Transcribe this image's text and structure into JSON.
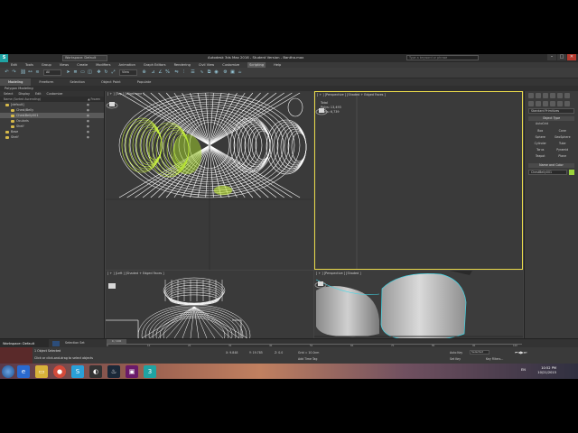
{
  "window": {
    "app_logo": "S",
    "workspace_dropdown": "Workspace: Default",
    "title": "Autodesk 3ds Max 2016 - Student Version  -  Bantha.max",
    "search_placeholder": "Type a keyword or phrase",
    "controls": [
      "–",
      "□",
      "✕"
    ]
  },
  "menu": [
    "Edit",
    "Tools",
    "Group",
    "Views",
    "Create",
    "Modifiers",
    "Animation",
    "Graph Editors",
    "Rendering",
    "Civil View",
    "Customize",
    "Scripting",
    "Help"
  ],
  "menu_active": "Scripting",
  "toolbar": {
    "selection_filter": "All",
    "view_dropdown": "View"
  },
  "ribbon": {
    "tabs": [
      "Modeling",
      "Freeform",
      "Selection",
      "Object Paint",
      "Populate"
    ],
    "active_tab": "Modeling",
    "sub": "Polygon Modeling"
  },
  "explorer": {
    "tabs": [
      "Select",
      "Display",
      "Edit",
      "Customize"
    ],
    "col_name": "Name (Sorted Ascending)",
    "col_frozen": "▲ Frozen",
    "items": [
      {
        "label": "[default]",
        "selected": false,
        "indent": 1
      },
      {
        "label": "Chest/Belly",
        "selected": false,
        "indent": 2
      },
      {
        "label": "ChestBelly001",
        "selected": true,
        "indent": 2
      },
      {
        "label": "Ocularis",
        "selected": false,
        "indent": 2
      },
      {
        "label": "Shelf",
        "selected": false,
        "indent": 2
      },
      {
        "label": "Base",
        "selected": false,
        "indent": 1
      },
      {
        "label": "Shelf",
        "selected": false,
        "indent": 1
      }
    ]
  },
  "viewports": {
    "top": {
      "label": "[ + ] [Top ] [Wireframe ]"
    },
    "persp_top": {
      "label": "[ + ] [Perspective ] [Shaded + Edged Faces ]",
      "stats": [
        "Total",
        "Polys:  13,493",
        "Verts:   6,739"
      ]
    },
    "front": {
      "label": "[ + ] [Left ] [Shaded + Edged Faces ]"
    },
    "persp": {
      "label": "[ + ] [Perspective ] [Shaded ]"
    }
  },
  "command_panel": {
    "dropdown": "Standard Primitives",
    "rollout_object_type": "Object Type",
    "autogrid": "AutoGrid",
    "object_buttons": [
      "Box",
      "Cone",
      "Sphere",
      "GeoSphere",
      "Cylinder",
      "Tube",
      "Torus",
      "Pyramid",
      "Teapot",
      "Plane"
    ],
    "rollout_name_color": "Name and Color",
    "object_name": "ChestBelly001",
    "object_color": "#9bd43c"
  },
  "timeline": {
    "workspace": "Workspace: Default",
    "frame": "0 / 100",
    "selection_set": "Selection Set",
    "ticks": [
      "0",
      "10",
      "20",
      "30",
      "40",
      "50",
      "60",
      "70",
      "80",
      "90",
      "100"
    ]
  },
  "status": {
    "selected": "1 Object Selected",
    "prompt": "Click or click-and-drag to select objects",
    "x": "X: 9.848",
    "y": "Y: 19.785",
    "z": "Z: 0.0",
    "grid": "Grid = 10.0cm",
    "add_time_tag": "Add Time Tag",
    "autokey": "Auto Key",
    "setkey": "Set Key",
    "selected_dropdown": "Selected",
    "key_filters": "Key Filters..."
  },
  "taskbar": {
    "time": "10:52 PM",
    "date": "10/21/2015",
    "lang": "EN"
  },
  "colors": {
    "wire_green": "#c8f040",
    "wire_white": "#ffffff",
    "selection_cyan": "#40d8e8",
    "active_border": "#e8d94a"
  }
}
